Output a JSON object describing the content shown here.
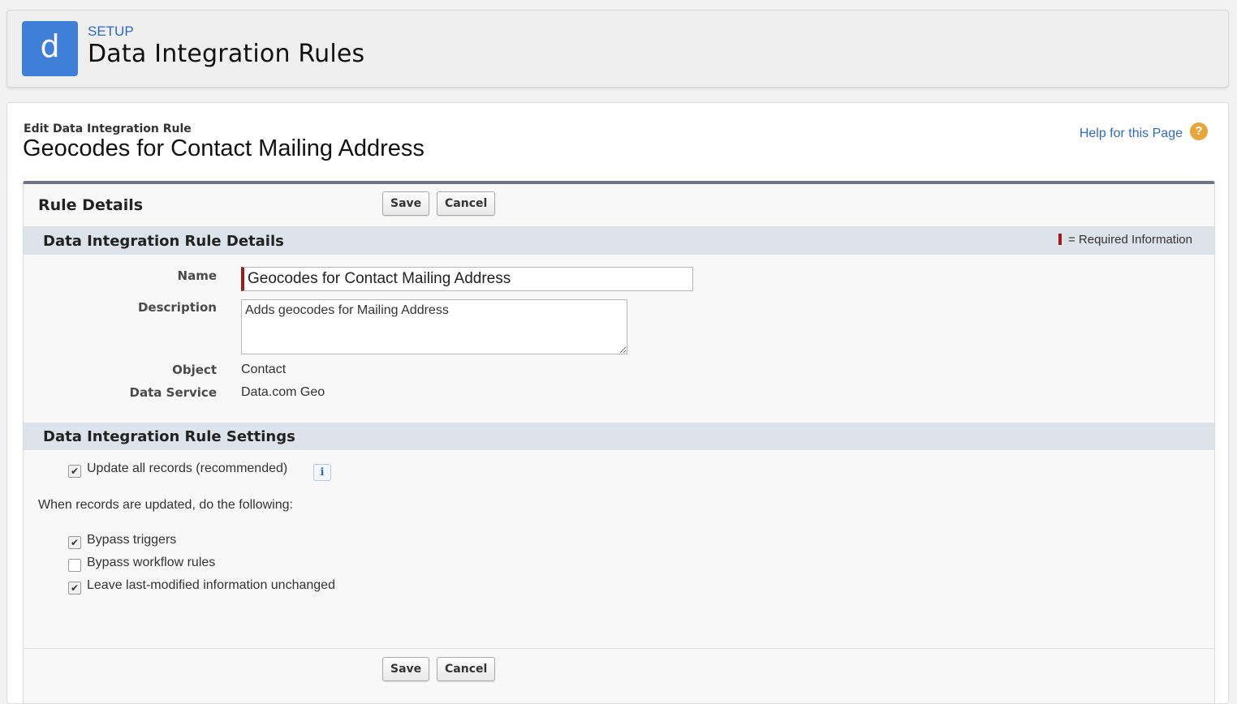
{
  "header": {
    "app_icon_letter": "d",
    "setup_label": "SETUP",
    "title": "Data Integration Rules"
  },
  "page": {
    "subtitle": "Edit Data Integration Rule",
    "title": "Geocodes for Contact Mailing Address",
    "help_link": "Help for this Page",
    "help_icon": "?"
  },
  "rule_details": {
    "title": "Rule Details",
    "save_label": "Save",
    "cancel_label": "Cancel"
  },
  "details_section": {
    "title": "Data Integration Rule Details",
    "required_legend": "= Required Information",
    "fields": {
      "name_label": "Name",
      "name_value": "Geocodes for Contact Mailing Address",
      "description_label": "Description",
      "description_value": "Adds geocodes for Mailing Address",
      "object_label": "Object",
      "object_value": "Contact",
      "data_service_label": "Data Service",
      "data_service_value": "Data.com Geo"
    }
  },
  "settings_section": {
    "title": "Data Integration Rule Settings",
    "update_all": {
      "label": "Update all records (recommended)",
      "checked": true
    },
    "info_icon": "i",
    "when_updated_text": "When records are updated, do the following:",
    "options": [
      {
        "label": "Bypass triggers",
        "checked": true
      },
      {
        "label": "Bypass workflow rules",
        "checked": false
      },
      {
        "label": "Leave last-modified information unchanged",
        "checked": true
      }
    ]
  },
  "footer": {
    "save_label": "Save",
    "cancel_label": "Cancel"
  },
  "colors": {
    "brand_blue": "#3f7fd8",
    "link_blue": "#2e6bc0",
    "required_red": "#a3191e",
    "section_bg": "#dde3ea",
    "help_orange": "#e8a53a"
  }
}
